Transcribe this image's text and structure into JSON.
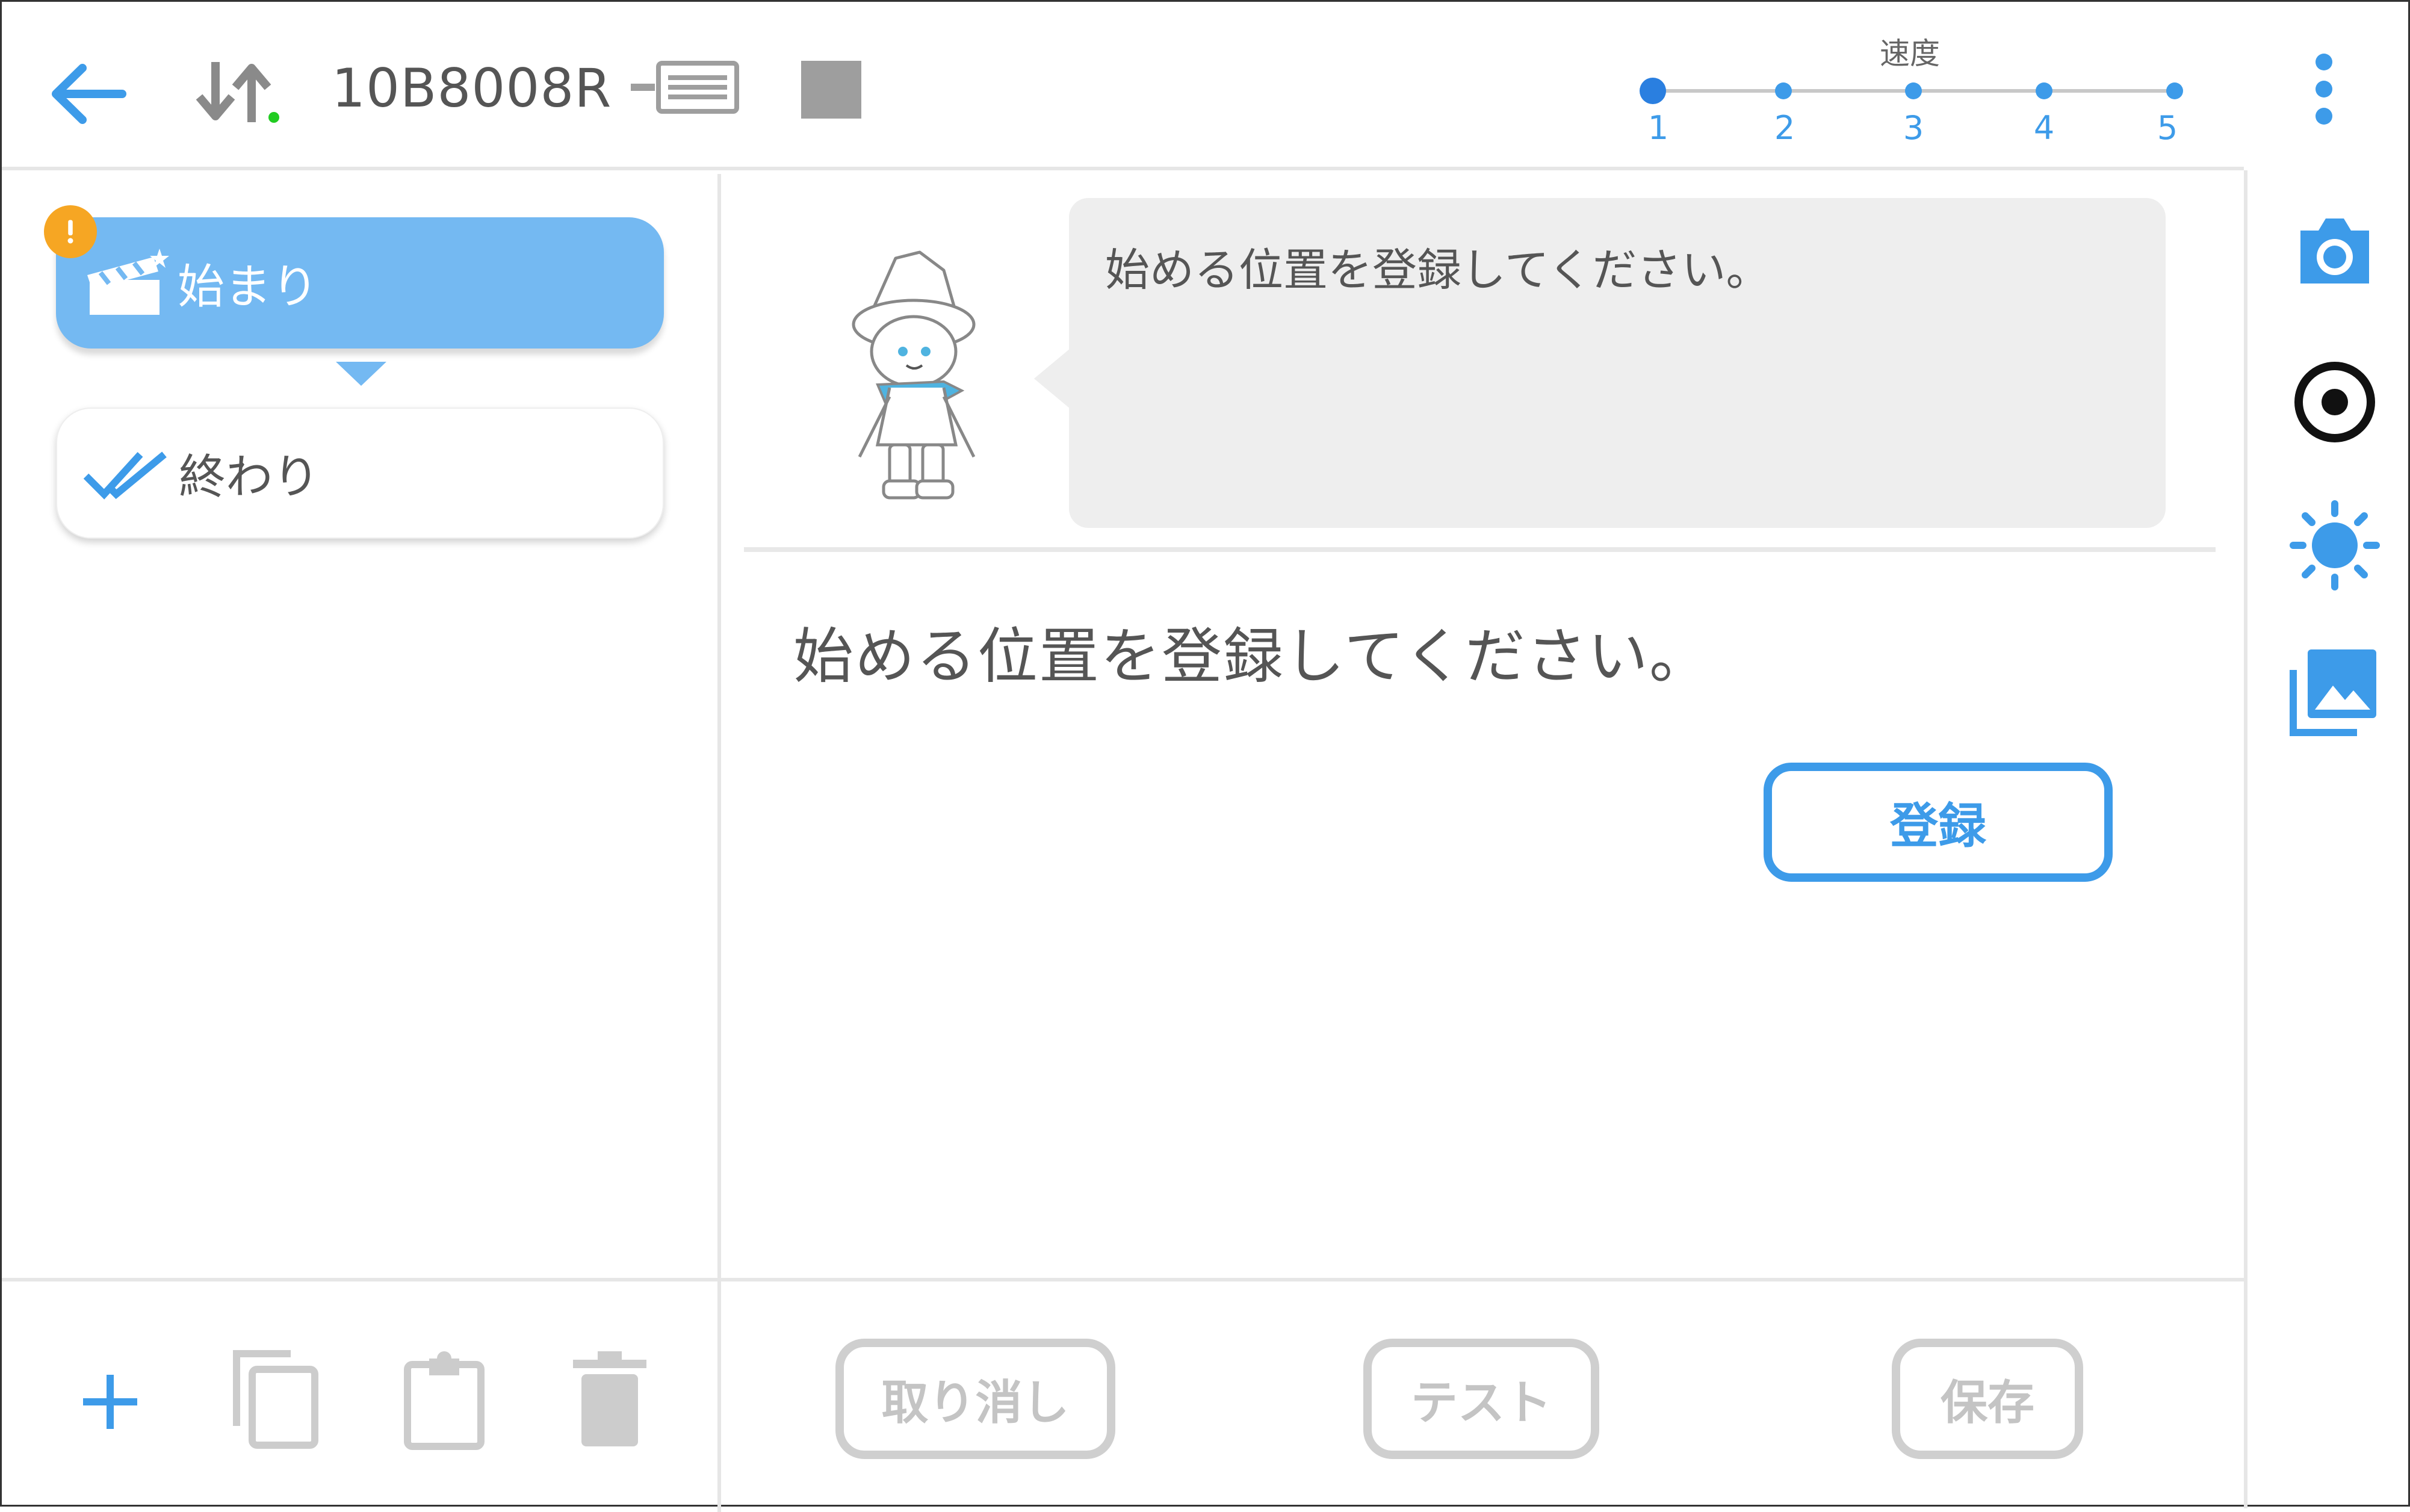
{
  "header": {
    "device_id": "10B8008R",
    "speed_label": "速度",
    "speed_levels": [
      "1",
      "2",
      "3",
      "4",
      "5"
    ],
    "speed_selected": 1
  },
  "steps": [
    {
      "label": "始まり",
      "icon": "clapperboard-icon",
      "selected": true,
      "warning": true
    },
    {
      "label": "終わり",
      "icon": "double-check-icon",
      "selected": false,
      "warning": false
    }
  ],
  "bubble": {
    "text": "始める位置を登録してください。"
  },
  "instruction": {
    "text": "始める位置を登録してください。"
  },
  "register_button": {
    "label": "登録"
  },
  "footer": {
    "cancel_label": "取り消し",
    "test_label": "テスト",
    "save_label": "保存"
  },
  "toolbar_icons": [
    "camera-icon",
    "record-target-icon",
    "brightness-icon",
    "gallery-icon"
  ],
  "colors": {
    "accent": "#3d9be9",
    "selected_step": "#74b9f2",
    "warning": "#f6a623",
    "disabled": "#c4c4c4"
  }
}
